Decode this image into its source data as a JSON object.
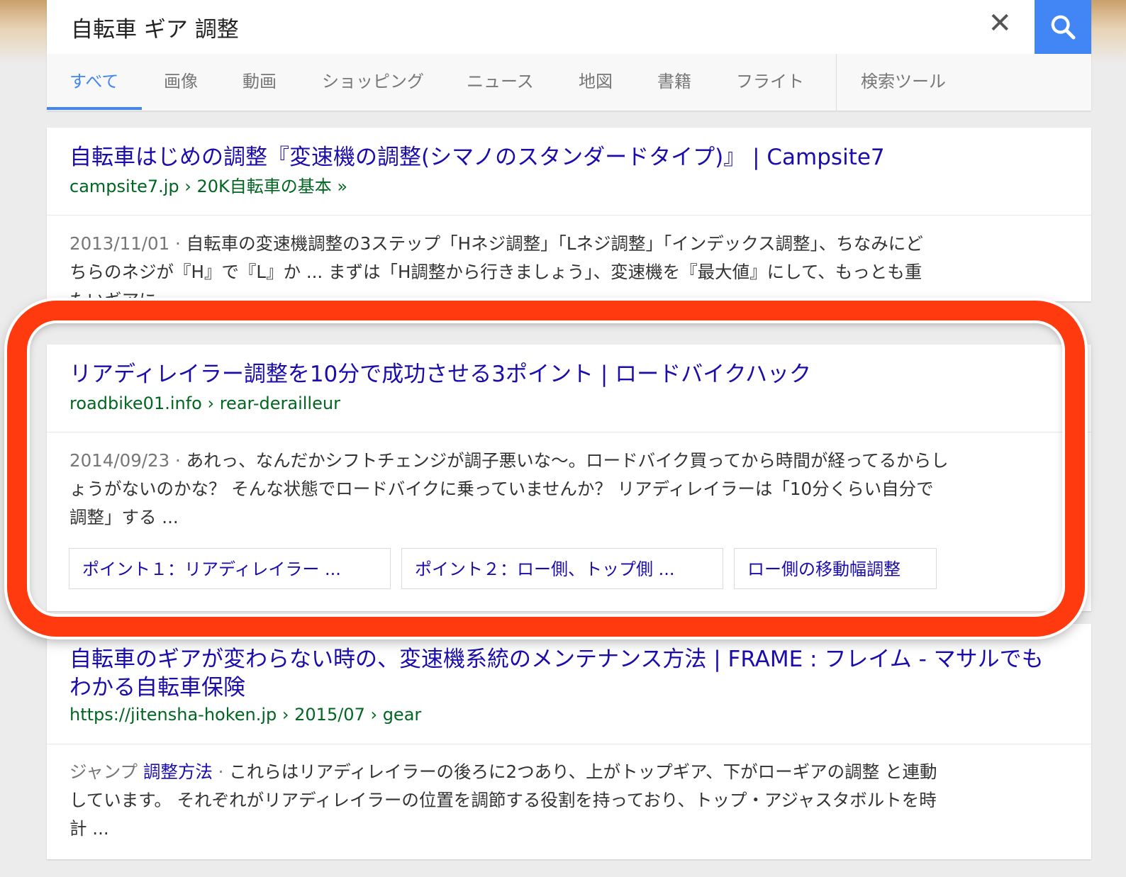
{
  "search": {
    "query": "自転車 ギア 調整",
    "clear_icon": "close-icon",
    "submit_icon": "search-icon",
    "button_color": "#4285f4"
  },
  "tabs": [
    {
      "label": "すべて",
      "active": true
    },
    {
      "label": "画像"
    },
    {
      "label": "動画"
    },
    {
      "label": "ショッピング"
    },
    {
      "label": "ニュース"
    },
    {
      "label": "地図"
    },
    {
      "label": "書籍"
    },
    {
      "label": "フライト"
    },
    {
      "label": "検索ツール"
    }
  ],
  "results": [
    {
      "title": "自転車はじめの調整『変速機の調整(シマノのスタンダードタイプ)』 | Campsite7",
      "url": "campsite7.jp › 20K自転車の基本 »",
      "date": "2013/11/01 ·",
      "snippet_line1": "自転車の変速機調整の3ステップ「Hネジ調整」「Lネジ調整」「インデックス調整」、ちなみにど",
      "snippet_line2": "ちらのネジが『H』で『L』か ... まずは「H調整から行きましょう」、変速機を『最大値』にして、もっとも重",
      "snippet_line3": "たいギアに"
    },
    {
      "title": "リアディレイラー調整を10分で成功させる3ポイント | ロードバイクハック",
      "url": "roadbike01.info › rear-derailleur",
      "date": "2014/09/23 ·",
      "snippet_line1": "あれっ、なんだかシフトチェンジが調子悪いな〜。ロードバイク買ってから時間が経ってるからし",
      "snippet_line2": "ょうがないのかな？ そんな状態でロードバイクに乗っていませんか？ リアディレイラーは「10分くらい自分で",
      "snippet_line3": "調整」する ...",
      "sitelinks": [
        "ポイント１：リアディレイラー ...",
        "ポイント２：ロー側、トップ側 ...",
        "ロー側の移動幅調整"
      ]
    },
    {
      "title_line1": "自転車のギアが変わらない時の、変速機系統のメンテナンス方法 | FRAME : フレイム - マサルでも",
      "title_line2": "わかる自転車保険",
      "url": "https://jitensha-hoken.jp › 2015/07 › gear",
      "jump_label": "ジャンプ",
      "jump_link": "調整方法",
      "snippet_line1": "これらはリアディレイラーの後ろに2つあり、上がトップギア、下がローギアの調整 と連動",
      "snippet_line2": "しています。 それぞれがリアディレイラーの位置を調節する役割を持っており、トップ・アジャスタボルトを時",
      "snippet_line3": "計 ..."
    }
  ],
  "highlight_color": "#ff3a0e"
}
